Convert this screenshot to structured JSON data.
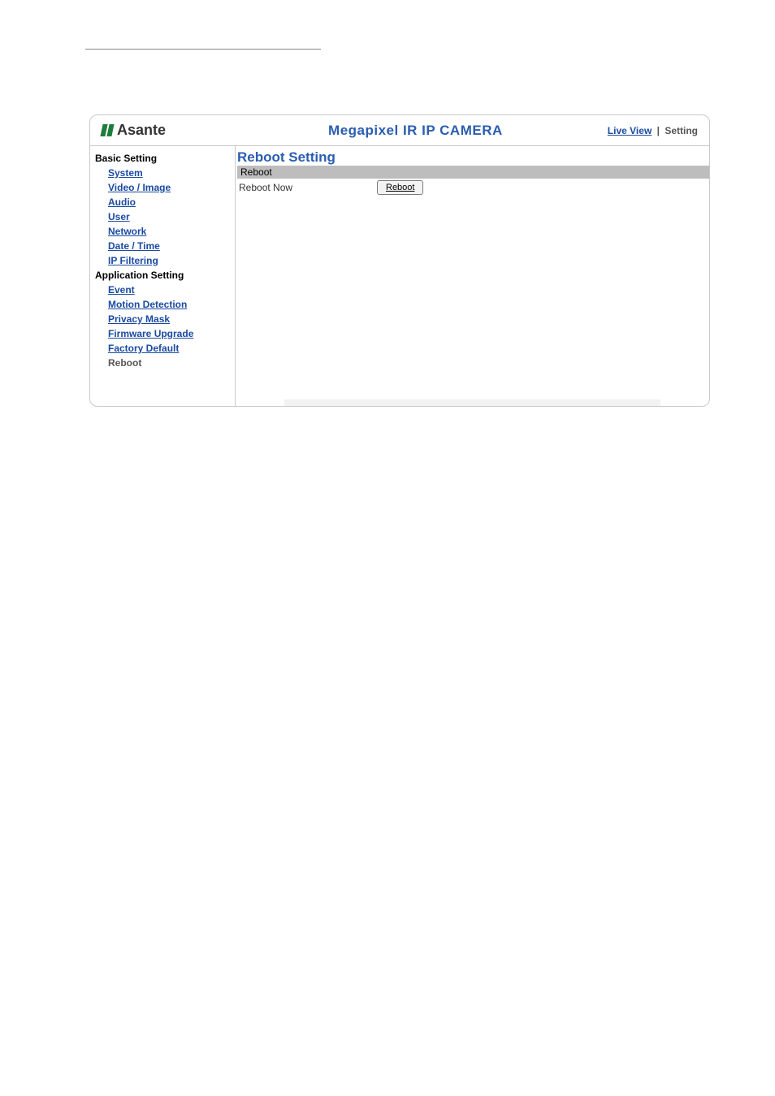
{
  "logo_text": "Asante",
  "product_title": "Megapixel IR IP CAMERA",
  "top_links": {
    "live_view": "Live View",
    "setting": "Setting"
  },
  "sidebar": {
    "basic_setting_title": "Basic Setting",
    "basic_items": {
      "system": "System",
      "video_image": "Video / Image",
      "audio": "Audio",
      "user": "User",
      "network": "Network",
      "date_time": "Date / Time",
      "ip_filtering": "IP Filtering"
    },
    "application_setting_title": "Application Setting",
    "app_items": {
      "event": "Event",
      "motion_detection": "Motion Detection",
      "privacy_mask": "Privacy Mask",
      "firmware_upgrade": "Firmware Upgrade",
      "factory_default": "Factory Default",
      "reboot": "Reboot"
    }
  },
  "content": {
    "title": "Reboot Setting",
    "section_bar": "Reboot",
    "row_label": "Reboot Now",
    "button_label": "Reboot"
  }
}
